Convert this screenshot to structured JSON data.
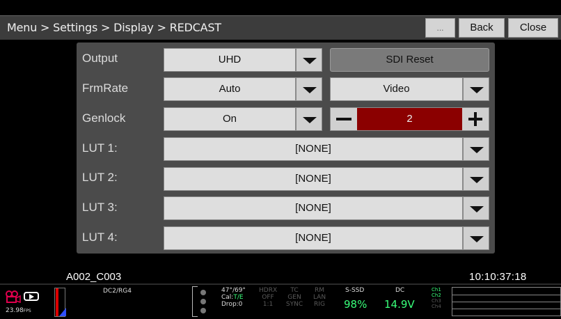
{
  "header": {
    "breadcrumb": "Menu > Settings > Display > REDCAST",
    "more_label": "...",
    "back_label": "Back",
    "close_label": "Close"
  },
  "rows": {
    "output": {
      "label": "Output",
      "value": "UHD"
    },
    "sdi_reset_label": "SDI Reset",
    "frmrate": {
      "label": "FrmRate",
      "value": "Auto",
      "secondary": "Video"
    },
    "genlock": {
      "label": "Genlock",
      "value": "On",
      "stepper_value": "2"
    },
    "luts": [
      {
        "label": "LUT 1:",
        "value": "[NONE]"
      },
      {
        "label": "LUT 2:",
        "value": "[NONE]"
      },
      {
        "label": "LUT 3:",
        "value": "[NONE]"
      },
      {
        "label": "LUT 4:",
        "value": "[NONE]"
      }
    ]
  },
  "clip": {
    "name": "A002_C003",
    "timecode": "10:10:37:18"
  },
  "status": {
    "fps": "23.98",
    "fps_unit": "FPS",
    "compression": "DC2/RG4",
    "temp": "47°/69°",
    "cal_label": "Cal:",
    "cal_value": "T/E",
    "drop": "Drop:0",
    "hdrx": [
      "HDRX",
      "OFF",
      "1:1"
    ],
    "tc": [
      "TC",
      "GEN",
      "SYNC"
    ],
    "rm": [
      "RM",
      "LAN",
      "RIG"
    ],
    "media_label": "S-SSD",
    "media_value": "98%",
    "power_label": "DC",
    "power_value": "14.9V",
    "channels": [
      "Ch1",
      "Ch2",
      "Ch3",
      "Ch4"
    ],
    "colors": {
      "accent_green": "#39ff7a",
      "record_red": "#8b0000"
    }
  }
}
